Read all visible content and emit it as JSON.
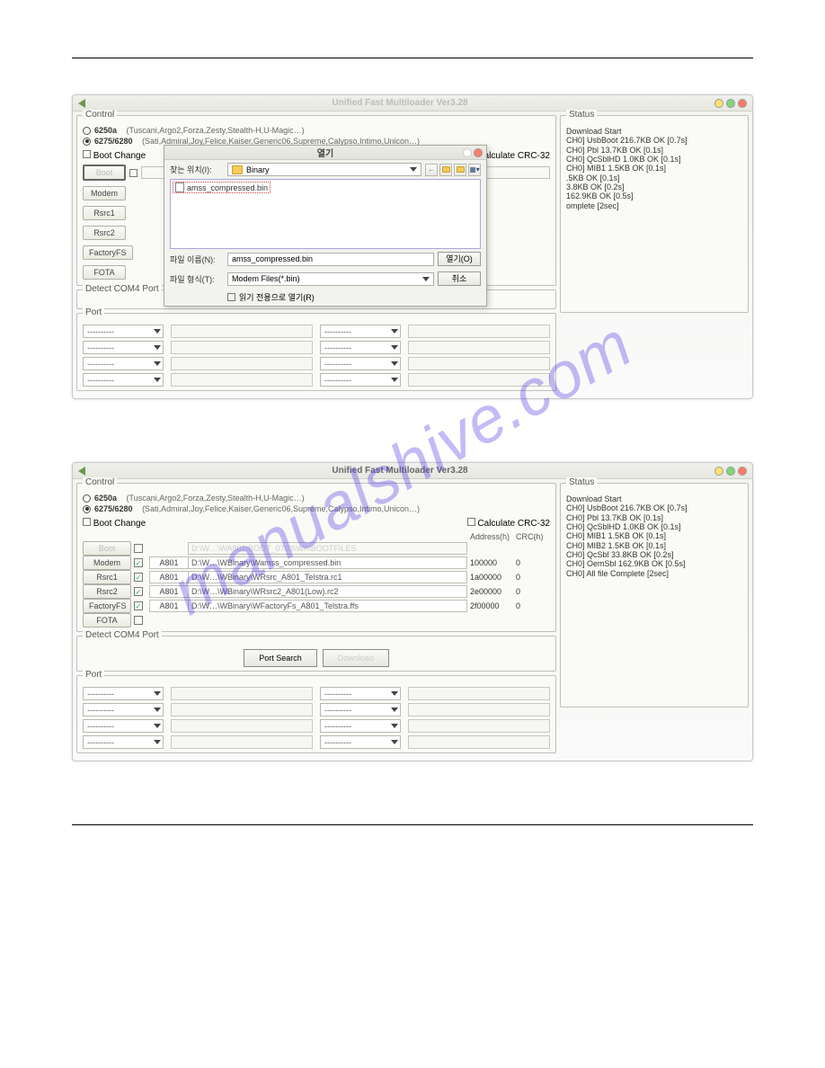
{
  "watermark": "manualshive.com",
  "window": {
    "title": "Unified Fast Multiloader Ver3.28"
  },
  "control": {
    "title": "Control",
    "opt1": {
      "code": "6250a",
      "desc": "(Tuscani,Argo2,Forza,Zesty,Stealth-H,U-Magic…)"
    },
    "opt2": {
      "code": "6275/6280",
      "desc": "(Sati,Admiral,Joy,Felice,Kaiser,Generic06,Supreme,Calypso,Intimo,Unicon…)"
    },
    "bootchange": "Boot Change",
    "crc": "Calculate CRC-32",
    "addr": "Address(h)",
    "crch": "CRC(h)",
    "bootlabel": "Boot",
    "bootpath": "D:\\W…\\WA801\\BOOT_0703\\WA\\BOOTFILES",
    "rows": {
      "modem": {
        "btn": "Modem",
        "code": "A801",
        "path": "D:\\W…\\WBinary\\Wamss_compressed.bin",
        "addr": "100000",
        "crc": "0"
      },
      "rsrc1": {
        "btn": "Rsrc1",
        "code": "A801",
        "path": "D:\\W…\\WBinary\\WRsrc_A801_Telstra.rc1",
        "addr": "1a00000",
        "crc": "0"
      },
      "rsrc2": {
        "btn": "Rsrc2",
        "code": "A801",
        "path": "D:\\W…\\WBinary\\WRsrc2_A801(Low).rc2",
        "addr": "2e00000",
        "crc": "0"
      },
      "factoryfs": {
        "btn": "FactoryFS",
        "code": "A801",
        "path": "D:\\W…\\WBinary\\WFactoryFs_A801_Telstra.ffs",
        "addr": "2f00000",
        "crc": "0"
      },
      "fota": {
        "btn": "FOTA"
      }
    },
    "detect": "Detect COM4 Port",
    "portsearch": "Port Search",
    "download": "Download"
  },
  "status": {
    "title": "Status",
    "lines": "Download Start\nCH0] UsbBoot 216.7KB OK [0.7s]\nCH0] Pbl 13.7KB OK [0.1s]\nCH0] QcSblHD 1.0KB OK [0.1s]\nCH0] MIB1 1.5KB OK [0.1s]\nCH0] MIB2 1.5KB OK [0.1s]\nCH0] QcSbl 33.8KB OK [0.2s]\nCH0] OemSbl 162.9KB OK [0.5s]\nCH0] All file Complete [2sec]",
    "lines_clip": "Download Start\nCH0] UsbBoot 216.7KB OK [0.7s]\nCH0] Pbl 13.7KB OK [0.1s]\nCH0] QcSblHD 1.0KB OK [0.1s]\nCH0] MIB1 1.5KB OK [0.1s]\n          .5KB OK [0.1s]\n          3.8KB OK [0.2s]\n          162.9KB OK [0.5s]\n          omplete [2sec]"
  },
  "port": {
    "title": "Port",
    "ph": "----------"
  },
  "dialog": {
    "title": "열기",
    "lookin": "찾는 위치(I):",
    "folder": "Binary",
    "item": "amss_compressed.bin",
    "filename_lbl": "파일 이름(N):",
    "filename": "amss_compressed.bin",
    "filetype_lbl": "파일 형식(T):",
    "filetype": "Modem Files(*.bin)",
    "readonly": "읽기 전용으로 열기(R)",
    "open": "열기(O)",
    "cancel": "취소"
  }
}
